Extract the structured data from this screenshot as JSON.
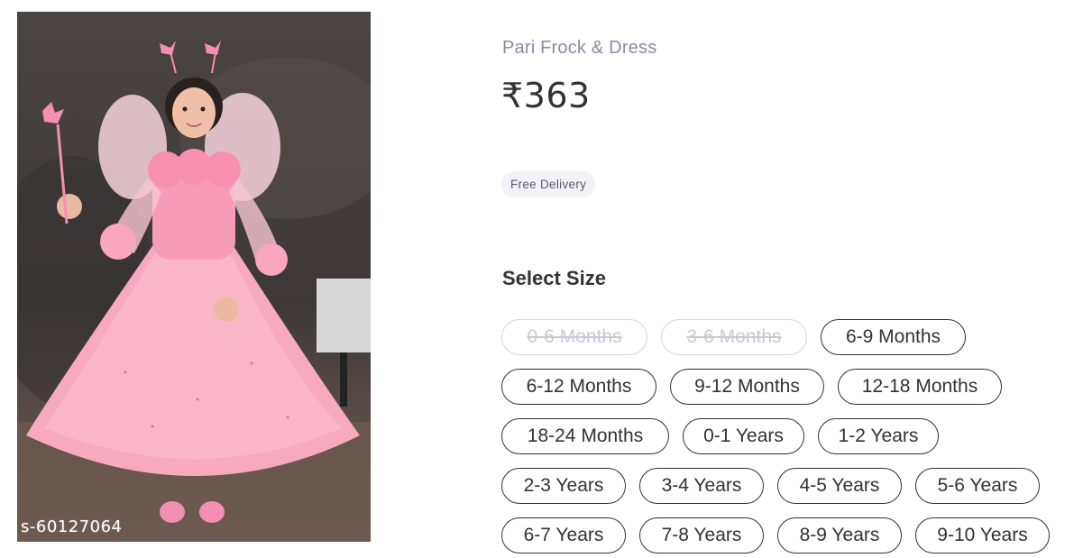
{
  "product_image": {
    "watermark": "s-60127064"
  },
  "product": {
    "title": "Pari Frock & Dress",
    "price": "₹363",
    "delivery_badge": "Free Delivery"
  },
  "sizes": {
    "heading": "Select Size",
    "options": [
      {
        "label": "0-6 Months",
        "available": false
      },
      {
        "label": "3-6 Months",
        "available": false
      },
      {
        "label": "6-9 Months",
        "available": true
      },
      {
        "label": "6-12 Months",
        "available": true
      },
      {
        "label": "9-12 Months",
        "available": true
      },
      {
        "label": "12-18 Months",
        "available": true
      },
      {
        "label": "18-24 Months",
        "available": true
      },
      {
        "label": "0-1 Years",
        "available": true
      },
      {
        "label": "1-2 Years",
        "available": true
      },
      {
        "label": "2-3 Years",
        "available": true
      },
      {
        "label": "3-4 Years",
        "available": true
      },
      {
        "label": "4-5 Years",
        "available": true
      },
      {
        "label": "5-6 Years",
        "available": true
      },
      {
        "label": "6-7 Years",
        "available": true
      },
      {
        "label": "7-8 Years",
        "available": true
      },
      {
        "label": "8-9 Years",
        "available": true
      },
      {
        "label": "9-10 Years",
        "available": true
      }
    ]
  }
}
